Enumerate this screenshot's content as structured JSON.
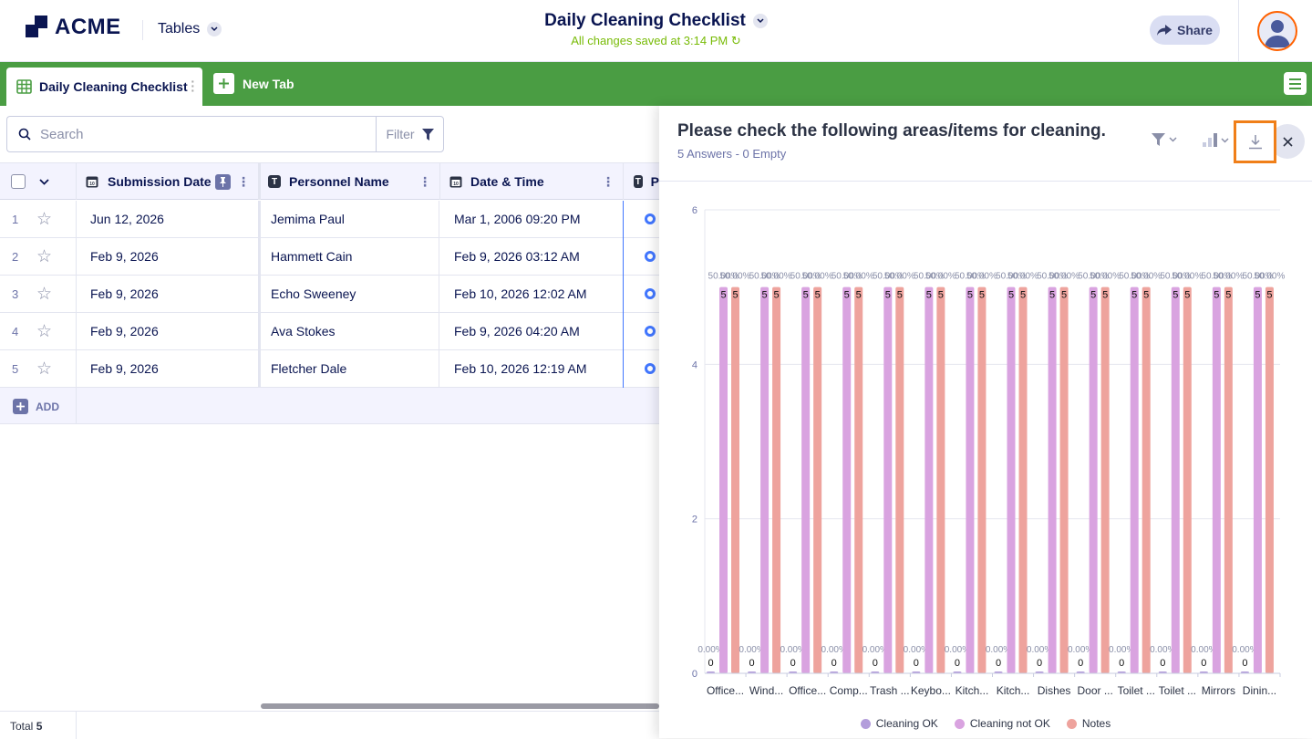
{
  "header": {
    "logo_text": "ACME",
    "section_label": "Tables",
    "doc_title": "Daily Cleaning Checklist",
    "saved_status": "All changes saved at 3:14 PM",
    "share_label": "Share"
  },
  "tabs": {
    "active_label": "Daily Cleaning Checklist",
    "new_tab_label": "New Tab"
  },
  "toolbar": {
    "search_placeholder": "Search",
    "filter_label": "Filter"
  },
  "table": {
    "columns": [
      {
        "label": "Submission Date",
        "icon": "calendar-icon"
      },
      {
        "label": "Personnel Name",
        "icon": "text-type-icon"
      },
      {
        "label": "Date & Time",
        "icon": "calendar-icon"
      },
      {
        "label": "P",
        "icon": "text-type-icon"
      }
    ],
    "rows": [
      {
        "num": "1",
        "submission_date": "Jun 12, 2026",
        "name": "Jemima Paul",
        "datetime": "Mar 1, 2006 09:20 PM"
      },
      {
        "num": "2",
        "submission_date": "Feb 9, 2026",
        "name": "Hammett Cain",
        "datetime": "Feb 9, 2026 03:12 AM"
      },
      {
        "num": "3",
        "submission_date": "Feb 9, 2026",
        "name": "Echo Sweeney",
        "datetime": "Feb 10, 2026 12:02 AM"
      },
      {
        "num": "4",
        "submission_date": "Feb 9, 2026",
        "name": "Ava Stokes",
        "datetime": "Feb 9, 2026 04:20 AM"
      },
      {
        "num": "5",
        "submission_date": "Feb 9, 2026",
        "name": "Fletcher Dale",
        "datetime": "Feb 10, 2026 12:19 AM"
      }
    ],
    "add_label": "ADD",
    "total_label": "Total",
    "total_count": "5"
  },
  "panel": {
    "title": "Please check the following areas/items for cleaning.",
    "subtitle": "5 Answers - 0 Empty"
  },
  "chart_data": {
    "type": "bar",
    "categories": [
      "Office...",
      "Wind...",
      "Office...",
      "Comp...",
      "Trash ...",
      "Keybo...",
      "Kitch...",
      "Kitch...",
      "Dishes",
      "Door ...",
      "Toilet ...",
      "Toilet ...",
      "Mirrors",
      "Dinin..."
    ],
    "series": [
      {
        "name": "Cleaning OK",
        "color": "#b39ddb",
        "values": [
          0,
          0,
          0,
          0,
          0,
          0,
          0,
          0,
          0,
          0,
          0,
          0,
          0,
          0
        ],
        "pct_label": "0.00%"
      },
      {
        "name": "Cleaning not OK",
        "color": "#d9a3e0",
        "values": [
          5,
          5,
          5,
          5,
          5,
          5,
          5,
          5,
          5,
          5,
          5,
          5,
          5,
          5
        ],
        "pct_label": "50.00%"
      },
      {
        "name": "Notes",
        "color": "#eea39d",
        "values": [
          5,
          5,
          5,
          5,
          5,
          5,
          5,
          5,
          5,
          5,
          5,
          5,
          5,
          5
        ],
        "pct_label": "50.00%"
      }
    ],
    "ylim": [
      0,
      6
    ],
    "yticks": [
      "0",
      "2",
      "4",
      "6"
    ],
    "grid": true,
    "legend_position": "bottom"
  }
}
